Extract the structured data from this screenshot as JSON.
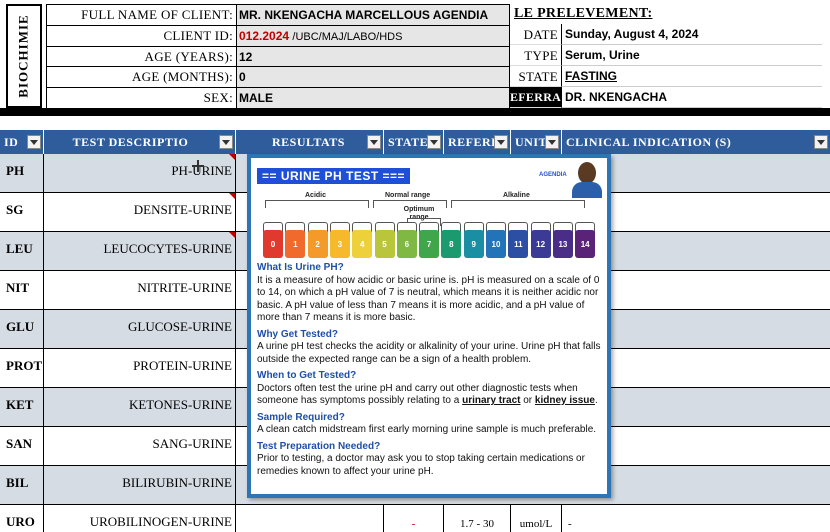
{
  "header": {
    "section_label": "BIOCHIMIE",
    "client_rows": [
      {
        "label": "FULL NAME OF CLIENT:",
        "value": "MR. NKENGACHA MARCELLOUS AGENDIA"
      },
      {
        "label": "CLIENT ID:",
        "value_main": "012.2024",
        "value_suffix": "/UBC/MAJ/LABO/HDS"
      },
      {
        "label": "AGE (YEARS):",
        "value": "12"
      },
      {
        "label": "AGE (MONTHS):",
        "value": "0"
      },
      {
        "label": "SEX:",
        "value": "MALE"
      }
    ],
    "prelevement": {
      "title": "LE PRELEVEMENT:",
      "rows": [
        {
          "label": "DATE",
          "value": "Sunday, August 4, 2024"
        },
        {
          "label": "TYPE",
          "value": "Serum, Urine"
        },
        {
          "label": "STATE",
          "value": "FASTING"
        },
        {
          "label": "EFERRAL",
          "value": "DR. NKENGACHA"
        }
      ]
    }
  },
  "columns": [
    {
      "label": "ID"
    },
    {
      "label": "TEST DESCRIPTIO"
    },
    {
      "label": "RESULTATS"
    },
    {
      "label": "STATE"
    },
    {
      "label": "REFERE"
    },
    {
      "label": "UNIT"
    },
    {
      "label": "CLINICAL INDICATION (S)"
    }
  ],
  "rows": [
    {
      "id": "PH",
      "desc": "PH-URINE"
    },
    {
      "id": "SG",
      "desc": "DENSITE-URINE"
    },
    {
      "id": "LEU",
      "desc": "LEUCOCYTES-URINE"
    },
    {
      "id": "NIT",
      "desc": "NITRITE-URINE"
    },
    {
      "id": "GLU",
      "desc": "GLUCOSE-URINE"
    },
    {
      "id": "PROT",
      "desc": "PROTEIN-URINE"
    },
    {
      "id": "KET",
      "desc": "KETONES-URINE"
    },
    {
      "id": "SAN",
      "desc": "SANG-URINE"
    },
    {
      "id": "BIL",
      "desc": "BILIRUBIN-URINE"
    },
    {
      "id": "URO",
      "desc": "UROBILINOGEN-URINE",
      "state": "-",
      "reference": "1.7 - 30",
      "unit": "umol/L",
      "indication": "-"
    }
  ],
  "popup": {
    "title": "== URINE PH TEST ===",
    "brand": "AGENDIA",
    "scale": {
      "acidic": "Acidic",
      "normal": "Normal range",
      "optimum": "Optimum range",
      "alkaline": "Alkaline",
      "values": [
        "0",
        "1",
        "2",
        "3",
        "4",
        "5",
        "6",
        "7",
        "8",
        "9",
        "10",
        "11",
        "12",
        "13",
        "14"
      ],
      "colors": [
        "#e03a2f",
        "#ef6a2c",
        "#f39a2b",
        "#f6b92c",
        "#eed13a",
        "#b9c63a",
        "#7fb843",
        "#3fa64a",
        "#1a9a6e",
        "#1a8fa3",
        "#2273b7",
        "#2d4fa3",
        "#3b3b95",
        "#4a2d86",
        "#5b2378"
      ]
    },
    "sections": [
      {
        "q": "What Is Urine PH?",
        "a": "It is a measure of how acidic or basic urine is. pH is measured on a scale of 0 to 14, on which a pH value of 7 is neutral, which means it is neither acidic nor basic. A pH value of less than 7 means it is more acidic, and a pH value of more than 7 means it is more basic."
      },
      {
        "q": "Why Get Tested?",
        "a": "A urine pH test checks the acidity or alkalinity of your urine. Urine pH that falls outside the expected range can be a sign of a health problem."
      },
      {
        "q": "When to Get Tested?",
        "a_pre": "Doctors often test the urine pH and carry out other diagnostic tests when someone has symptoms possibly relating to a ",
        "a_link1": "urinary tract",
        "a_mid": " or ",
        "a_link2": "kidney issue",
        "a_post": "."
      },
      {
        "q": "Sample Required?",
        "a": "A clean catch midstream first early morning urine sample is much preferable."
      },
      {
        "q": "Test Preparation Needed?",
        "a": "Prior to testing, a doctor may ask you to stop taking certain medications or remedies known to affect your urine pH."
      }
    ]
  }
}
